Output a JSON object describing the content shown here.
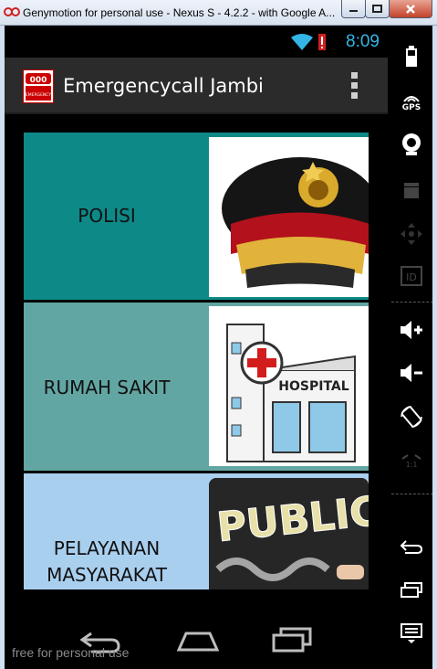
{
  "window": {
    "title": "Genymotion for personal use - Nexus S - 4.2.2 - with Google A...",
    "buttons": [
      "minimize",
      "maximize",
      "close"
    ]
  },
  "status_bar": {
    "time": "8:09",
    "icons": [
      "wifi-icon",
      "signal-alert-icon"
    ]
  },
  "action_bar": {
    "title": "Emergencycall Jambi",
    "icon_text": "000",
    "icon_subtext": "EMERGENCY",
    "overflow_icon": "overflow-menu-icon"
  },
  "cards": [
    {
      "label": "POLISI",
      "image": "police-cap-image",
      "color": "#0d8a88"
    },
    {
      "label": "RUMAH SAKIT",
      "image": "hospital-image",
      "color": "#62a6a3",
      "image_text": "HOSPITAL"
    },
    {
      "label": "PELAYANAN MASYARAKAT",
      "image": "public-service-chalkboard-image",
      "color": "#a9cfef",
      "image_text": "PUBLIC"
    }
  ],
  "nav_bar": {
    "buttons": [
      "back-icon",
      "home-icon",
      "recent-apps-icon"
    ],
    "watermark": "free for personal use"
  },
  "side_panel": {
    "gps_label": "GPS",
    "id_label": "ID",
    "scale_label": "1:1",
    "items": [
      "battery-icon",
      "gps-icon",
      "camera-icon",
      "media-icon",
      "dpad-icon",
      "id-icon",
      "volume-up-icon",
      "volume-down-icon",
      "rotate-icon",
      "scale-icon",
      "back-icon",
      "recent-apps-icon",
      "menu-icon"
    ]
  },
  "colors": {
    "accent": "#33b5e5",
    "action_bar": "#2b2b2b"
  }
}
